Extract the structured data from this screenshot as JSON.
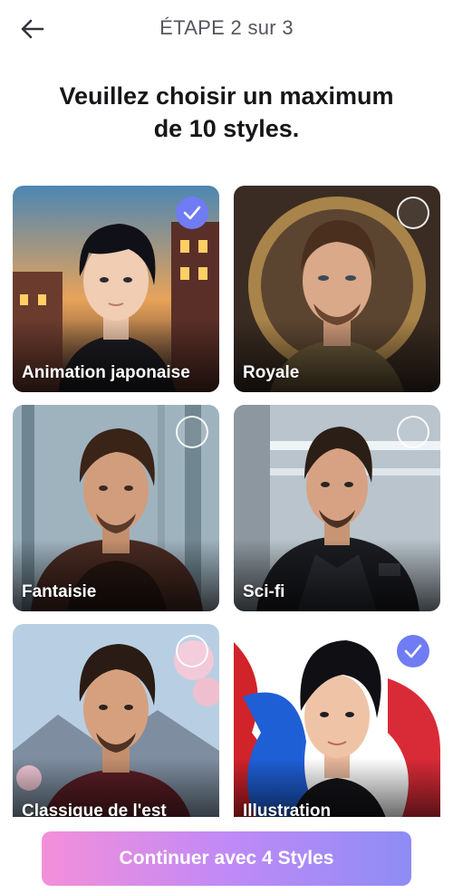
{
  "header": {
    "step_title": "ÉTAPE 2 sur 3",
    "back_icon": "arrow-left-icon"
  },
  "headline": {
    "line1": "Veuillez choisir un maximum",
    "line2": "de 10 styles."
  },
  "styles": [
    {
      "label": "Animation japonaise",
      "selected": true
    },
    {
      "label": "Royale",
      "selected": false
    },
    {
      "label": "Fantaisie",
      "selected": false
    },
    {
      "label": "Sci-fi",
      "selected": false
    },
    {
      "label": "Classique de l'est",
      "selected": false
    },
    {
      "label": "Illustration",
      "selected": true
    }
  ],
  "cta": {
    "label": "Continuer avec 4 Styles"
  },
  "colors": {
    "accent": "#6f7cf4",
    "cta_start": "#f48fd9",
    "cta_end": "#8e8cf5"
  }
}
